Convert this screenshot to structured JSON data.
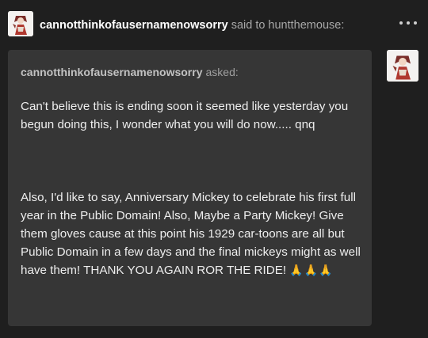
{
  "header": {
    "username": "cannotthinkofausernamenowsorry",
    "said_text": "said to",
    "recipient": "huntthemouse:",
    "more_icon": "more-horizontal-icon"
  },
  "ask": {
    "asker": "cannotthinkofausernamenowsorry",
    "asked_text": "asked:",
    "paragraph1": "Can't believe this is ending soon it seemed like yesterday you begun doing this, I wonder what you will do now..... qnq",
    "paragraph2": "Also, I'd like to say, Anniversary Mickey to celebrate his first full year in the Public Domain! Also, Maybe a Party Mickey! Give them gloves cause at this point his 1929 car-toons are all but Public Domain in a few days and the final mickeys might as well have them! THANK YOU AGAIN ROR THE RIDE!",
    "emoji": "🙏🙏🙏"
  },
  "colors": {
    "background": "#1f1f1f",
    "card": "#363636",
    "text": "#eeeeee",
    "muted": "#a8a8a8"
  }
}
